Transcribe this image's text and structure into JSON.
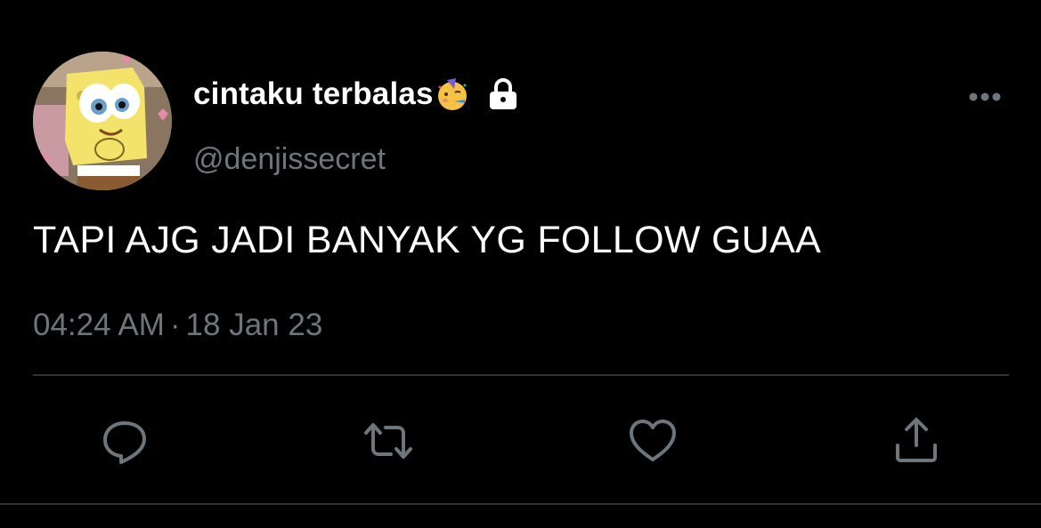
{
  "user": {
    "display_name": "cintaku terbalas",
    "handle": "@denjissecret",
    "protected": true
  },
  "tweet": {
    "text": "TAPI AJG JADI BANYAK YG FOLLOW GUAA",
    "time": "04:24 AM",
    "separator": "·",
    "date": "18 Jan 23"
  },
  "actions": [
    "reply-icon",
    "retweet-icon",
    "like-icon",
    "share-icon"
  ],
  "colors": {
    "background": "#000000",
    "text_primary": "#ffffff",
    "text_secondary": "#6e767d",
    "divider": "#2f3336"
  }
}
